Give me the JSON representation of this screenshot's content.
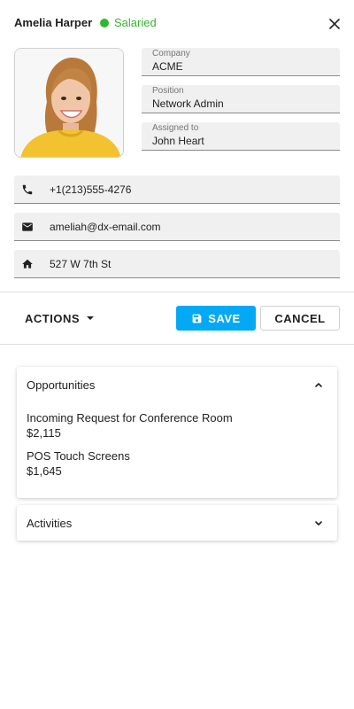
{
  "header": {
    "name": "Amelia Harper",
    "status": "Salaried",
    "status_color": "#2eb82e"
  },
  "fields": {
    "company": {
      "label": "Company",
      "value": "ACME"
    },
    "position": {
      "label": "Position",
      "value": "Network Admin"
    },
    "assigned_to": {
      "label": "Assigned to",
      "value": "John Heart"
    }
  },
  "contacts": {
    "phone": {
      "icon": "phone-icon",
      "value": "+1(213)555-4276"
    },
    "email": {
      "icon": "email-icon",
      "value": "ameliah@dx-email.com"
    },
    "address": {
      "icon": "home-icon",
      "value": "527 W 7th St"
    }
  },
  "toolbar": {
    "actions_label": "ACTIONS",
    "save_label": "SAVE",
    "cancel_label": "CANCEL",
    "accent": "#03a9f4"
  },
  "opportunities": {
    "title": "Opportunities",
    "expanded": true,
    "items": [
      {
        "name": "Incoming Request for Conference Room",
        "amount": "$2,115"
      },
      {
        "name": "POS Touch Screens",
        "amount": "$1,645"
      }
    ]
  },
  "activities": {
    "title": "Activities",
    "expanded": false
  }
}
